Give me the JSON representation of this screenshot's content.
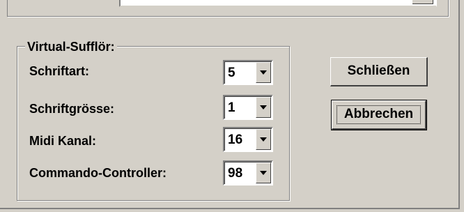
{
  "group": {
    "title": "Virtual-Sufflör:"
  },
  "fields": [
    {
      "label": "Schriftart:",
      "value": "5"
    },
    {
      "label": "Schriftgrösse:",
      "value": "1"
    },
    {
      "label": "Midi Kanal:",
      "value": "16"
    },
    {
      "label": "Commando-Controller:",
      "value": "98"
    }
  ],
  "buttons": {
    "close_label": "Schließen",
    "cancel_label": "Abbrechen"
  },
  "icons": {
    "dropdown": "chevron-down-icon"
  },
  "colors": {
    "dialog_bg": "#d4d0c8",
    "field_bg": "#ffffff"
  }
}
